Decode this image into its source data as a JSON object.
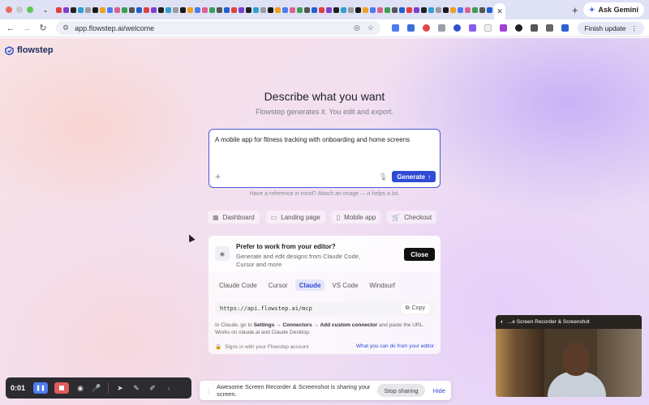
{
  "browser": {
    "ask_gemini_label": "Ask Gemini",
    "url": "app.flowstep.ai/welcome",
    "finish_update_label": "Finish update",
    "new_tab_symbol": "+",
    "close_tab_symbol": "✕"
  },
  "app": {
    "logo_text": "flowstep",
    "hero_title": "Describe what you want",
    "hero_subtitle": "Flowstep generates it. You edit and export.",
    "prompt_value": "A mobile app for fitness tracking with onboarding and home screens",
    "generate_label": "Generate",
    "hint": "Have a reference in mind? Attach an image — it helps a lot.",
    "chips": [
      {
        "label": "Dashboard",
        "icon": "grid-icon"
      },
      {
        "label": "Landing page",
        "icon": "layout-icon"
      },
      {
        "label": "Mobile app",
        "icon": "phone-icon"
      },
      {
        "label": "Checkout",
        "icon": "cart-icon"
      }
    ],
    "editor_card": {
      "title": "Prefer to work from your editor?",
      "description": "Generate and edit designs from Claude Code, Cursor and more",
      "close_label": "Close",
      "tabs": [
        {
          "label": "Claude Code",
          "active": false
        },
        {
          "label": "Cursor",
          "active": false
        },
        {
          "label": "Claude",
          "active": true
        },
        {
          "label": "VS Code",
          "active": false
        },
        {
          "label": "Windsurf",
          "active": false
        }
      ],
      "mcp_url": "https://api.flowstep.ai/mcp",
      "copy_label": "Copy",
      "instructions_prefix": "In Claude, go to ",
      "instructions_path": "Settings → Connectors → Add custom connector",
      "instructions_suffix": " and paste the URL. Works on claude.ai and Claude Desktop.",
      "signs_in": "Signs in with your Flowstep account",
      "what_you_can_link": "What you can do from your editor"
    }
  },
  "recorder": {
    "time": "0:01",
    "share_message": "Awesome Screen Recorder & Screenshot is sharing your screen.",
    "stop_sharing_label": "Stop sharing",
    "hide_label": "Hide",
    "camera_title": "...e Screen Recorder & Screenshot"
  },
  "colors": {
    "accent": "#2f4bd6",
    "record_stop": "#e05a5a",
    "record_pause": "#4f7cf0"
  }
}
